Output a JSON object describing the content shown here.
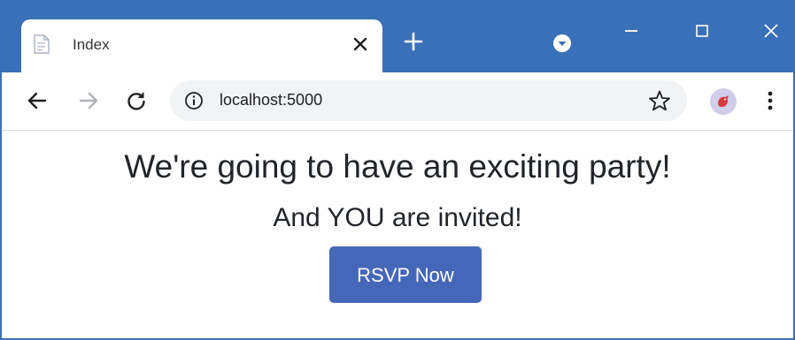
{
  "browser": {
    "tab": {
      "title": "Index",
      "favicon": "page-icon",
      "close": "close-icon"
    },
    "new_tab": "plus-icon",
    "window_controls": [
      "minimize-icon",
      "maximize-icon",
      "close-icon"
    ],
    "toolbar": {
      "back": "arrow-left-icon",
      "forward": "arrow-right-icon",
      "reload": "reload-icon",
      "url": "localhost:5000",
      "bookmark": "star-icon",
      "menu": "kebab-menu-icon"
    },
    "colors": {
      "frame": "#3a70b8",
      "omnibox": "#f1f3f4"
    }
  },
  "page": {
    "headline": "We're going to have an exciting party!",
    "subhead": "And YOU are invited!",
    "rsvp_label": "RSVP Now",
    "colors": {
      "button": "#4567b7",
      "text": "#212529"
    }
  }
}
